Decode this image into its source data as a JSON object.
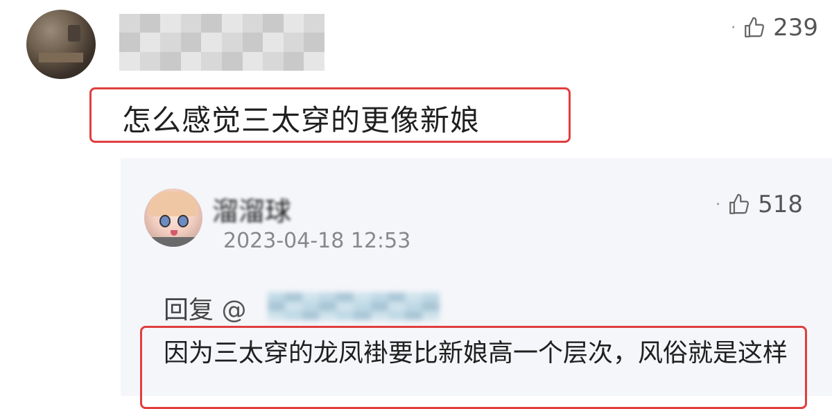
{
  "top_comment": {
    "likes": "239",
    "text": "怎么感觉三太穿的更像新娘"
  },
  "reply": {
    "username": "溜溜球",
    "timestamp": "2023-04-18 12:53",
    "likes": "518",
    "reply_label": "回复",
    "at_sign": "@",
    "text": "因为三太穿的龙凤褂要比新娘高一个层次，风俗就是这样"
  },
  "icons": {
    "like": "thumbs-up-icon",
    "more": "dot-menu-icon"
  },
  "colors": {
    "highlight_border": "#e03e3e",
    "reply_panel_bg": "#f5f6fa"
  }
}
